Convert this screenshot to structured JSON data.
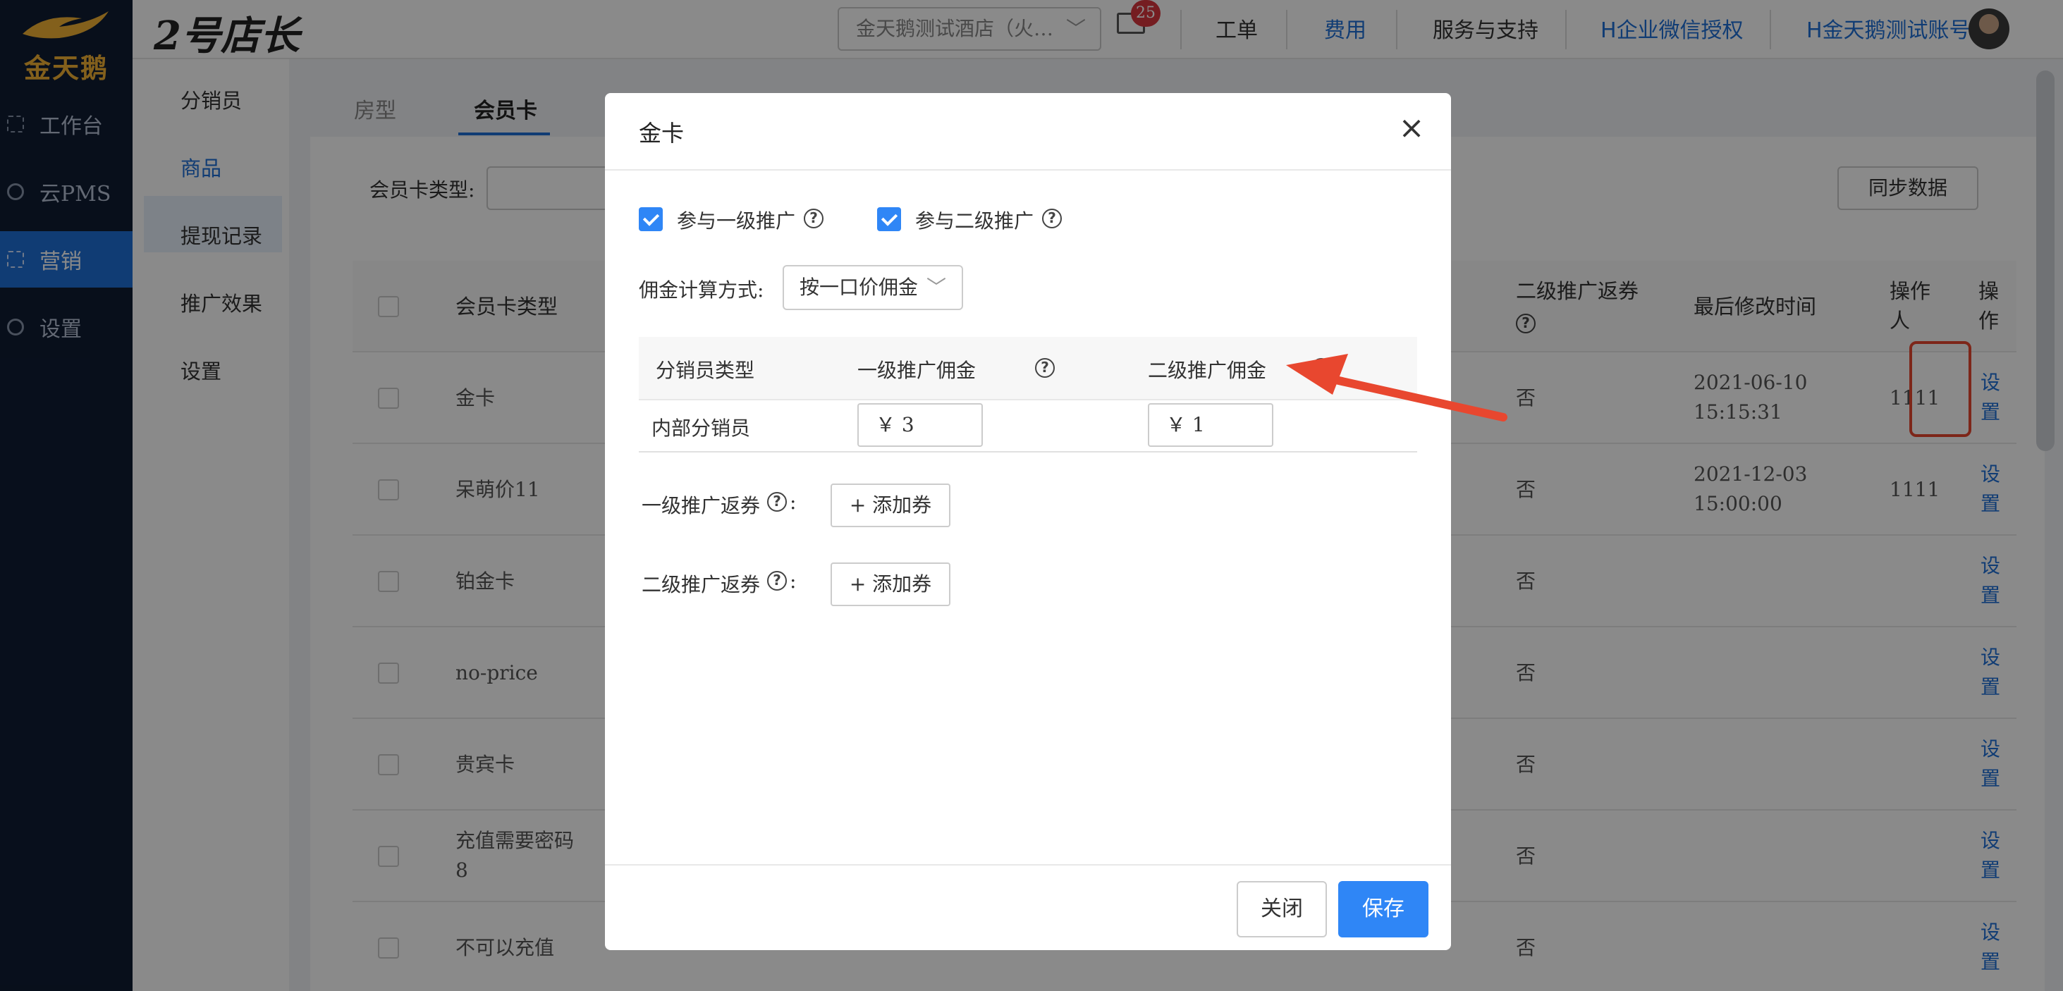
{
  "brand": {
    "logo_text": "金天鹅",
    "app_name": "2号店长"
  },
  "sidebar": {
    "items": [
      {
        "label": "工作台",
        "icon": "workbench-icon"
      },
      {
        "label": "云PMS",
        "icon": "gear-icon"
      },
      {
        "label": "营销",
        "icon": "marketing-icon",
        "active": true
      },
      {
        "label": "设置",
        "icon": "gear-icon"
      }
    ]
  },
  "header": {
    "hotel_select": "金天鹅测试酒店（火…",
    "mail_badge": "25",
    "links": [
      "工单",
      "费用",
      "服务与支持",
      "企业微信授权",
      "金天鹅测试账号"
    ]
  },
  "submenu": {
    "items": [
      "分销员",
      "商品",
      "提现记录",
      "推广效果",
      "设置"
    ],
    "active": "商品"
  },
  "main": {
    "tabs": [
      "房型",
      "会员卡"
    ],
    "active_tab": "会员卡",
    "filter_label": "会员卡类型:",
    "sync_button": "同步数据",
    "table": {
      "headers": {
        "card_type": "会员卡类型",
        "level2_coupon_1": "二级推广返券",
        "last_modified": "最后修改时间",
        "operator_1": "操作",
        "operator_2": "人",
        "action_1": "操",
        "action_2": "作"
      },
      "rows": [
        {
          "name": "金卡",
          "level2_coupon": "否",
          "date": "2021-06-10",
          "time": "15:15:31",
          "operator": "1111",
          "action_1": "设",
          "action_2": "置"
        },
        {
          "name": "呆萌价11",
          "level2_coupon": "否",
          "date": "2021-12-03",
          "time": "15:00:00",
          "operator": "1111",
          "action_1": "设",
          "action_2": "置"
        },
        {
          "name": "铂金卡",
          "level2_coupon": "否",
          "date": "",
          "time": "",
          "operator": "",
          "action_1": "设",
          "action_2": "置"
        },
        {
          "name": "no-price",
          "level2_coupon": "否",
          "date": "",
          "time": "",
          "operator": "",
          "action_1": "设",
          "action_2": "置"
        },
        {
          "name": "贵宾卡",
          "level2_coupon": "否",
          "date": "",
          "time": "",
          "operator": "",
          "action_1": "设",
          "action_2": "置"
        },
        {
          "name": "充值需要密码",
          "name_line2": "8",
          "level2_coupon": "否",
          "date": "",
          "time": "",
          "operator": "",
          "action_1": "设",
          "action_2": "置"
        },
        {
          "name": "不可以充值",
          "level2_coupon": "否",
          "date": "",
          "time": "",
          "operator": "",
          "action_1": "设",
          "action_2": "置"
        }
      ]
    }
  },
  "modal": {
    "title": "金卡",
    "checkbox_level1": "参与一级推广",
    "checkbox_level2": "参与二级推广",
    "calc_label": "佣金计算方式:",
    "calc_value": "按一口价佣金",
    "commission_table": {
      "headers": [
        "分销员类型",
        "一级推广佣金",
        "二级推广佣金"
      ],
      "row": {
        "type": "内部分销员",
        "level1": "￥ 3",
        "level2": "￥ 1"
      }
    },
    "level1_coupon_label": "一级推广返券",
    "level2_coupon_label": "二级推广返券",
    "colon": ":",
    "add_coupon": "+ 添加券",
    "close_button": "关闭",
    "save_button": "保存"
  },
  "colors": {
    "primary": "#2f86f6",
    "sidebar_bg": "#0f1c33",
    "annotation_red": "#e8472f"
  }
}
